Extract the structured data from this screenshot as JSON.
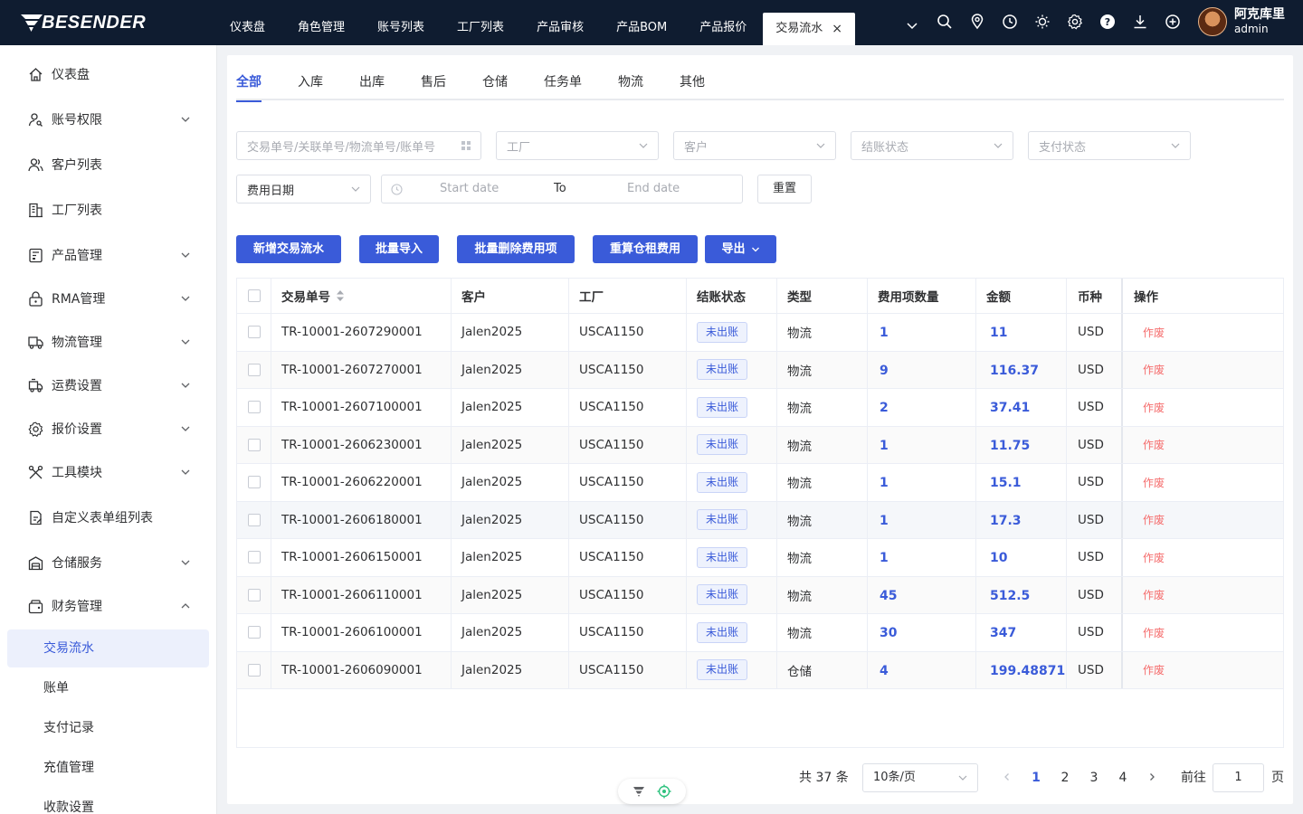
{
  "brand": "BESENDER",
  "topnav": {
    "items": [
      "仪表盘",
      "角色管理",
      "账号列表",
      "工厂列表",
      "产品审核",
      "产品BOM",
      "产品报价"
    ],
    "active_tab": "交易流水",
    "close_symbol": "×"
  },
  "top_icons": [
    "search-icon",
    "location-icon",
    "clock-icon",
    "sun-icon",
    "gear-icon",
    "help-icon",
    "download-icon",
    "plus-circle-icon"
  ],
  "user": {
    "name": "阿克库里",
    "role": "admin"
  },
  "sidebar": {
    "items": [
      {
        "label": "仪表盘",
        "icon": "home-icon",
        "has_children": false
      },
      {
        "label": "账号权限",
        "icon": "user-key-icon",
        "has_children": true
      },
      {
        "label": "客户列表",
        "icon": "users-icon",
        "has_children": false
      },
      {
        "label": "工厂列表",
        "icon": "building-icon",
        "has_children": false
      },
      {
        "label": "产品管理",
        "icon": "product-icon",
        "has_children": true
      },
      {
        "label": "RMA管理",
        "icon": "lock-icon",
        "has_children": true
      },
      {
        "label": "物流管理",
        "icon": "truck-icon",
        "has_children": true
      },
      {
        "label": "运费设置",
        "icon": "freight-icon",
        "has_children": true
      },
      {
        "label": "报价设置",
        "icon": "gear-icon",
        "has_children": true
      },
      {
        "label": "工具模块",
        "icon": "tools-icon",
        "has_children": true
      },
      {
        "label": "自定义表单组列表",
        "icon": "form-icon",
        "has_children": false
      },
      {
        "label": "仓储服务",
        "icon": "warehouse-icon",
        "has_children": true
      },
      {
        "label": "财务管理",
        "icon": "finance-icon",
        "has_children": true,
        "expanded": true
      }
    ],
    "sub_items": [
      "交易流水",
      "账单",
      "支付记录",
      "充值管理",
      "收款设置"
    ],
    "active_sub": "交易流水"
  },
  "tabs": [
    "全部",
    "入库",
    "出库",
    "售后",
    "仓储",
    "任务单",
    "物流",
    "其他"
  ],
  "active_tab_index": 0,
  "filters": {
    "search_placeholder": "交易单号/关联单号/物流单号/账单号",
    "factory_placeholder": "工厂",
    "customer_placeholder": "客户",
    "settle_status_placeholder": "结账状态",
    "pay_status_placeholder": "支付状态",
    "date_type": "费用日期",
    "start_placeholder": "Start date",
    "range_separator": "To",
    "end_placeholder": "End date",
    "reset_label": "重置"
  },
  "actions": {
    "add": "新增交易流水",
    "import": "批量导入",
    "batch_delete": "批量删除费用项",
    "recalc": "重算仓租费用",
    "export": "导出"
  },
  "table": {
    "columns": [
      "交易单号",
      "客户",
      "工厂",
      "结账状态",
      "类型",
      "费用项数量",
      "金额",
      "币种",
      "操作"
    ],
    "rows": [
      {
        "id": "TR-10001-2607290001",
        "customer": "Jalen2025",
        "factory": "USCA1150",
        "status": "未出账",
        "type": "物流",
        "count": "1",
        "amount": "11",
        "currency": "USD",
        "action": "作废"
      },
      {
        "id": "TR-10001-2607270001",
        "customer": "Jalen2025",
        "factory": "USCA1150",
        "status": "未出账",
        "type": "物流",
        "count": "9",
        "amount": "116.37",
        "currency": "USD",
        "action": "作废"
      },
      {
        "id": "TR-10001-2607100001",
        "customer": "Jalen2025",
        "factory": "USCA1150",
        "status": "未出账",
        "type": "物流",
        "count": "2",
        "amount": "37.41",
        "currency": "USD",
        "action": "作废"
      },
      {
        "id": "TR-10001-2606230001",
        "customer": "Jalen2025",
        "factory": "USCA1150",
        "status": "未出账",
        "type": "物流",
        "count": "1",
        "amount": "11.75",
        "currency": "USD",
        "action": "作废"
      },
      {
        "id": "TR-10001-2606220001",
        "customer": "Jalen2025",
        "factory": "USCA1150",
        "status": "未出账",
        "type": "物流",
        "count": "1",
        "amount": "15.1",
        "currency": "USD",
        "action": "作废"
      },
      {
        "id": "TR-10001-2606180001",
        "customer": "Jalen2025",
        "factory": "USCA1150",
        "status": "未出账",
        "type": "物流",
        "count": "1",
        "amount": "17.3",
        "currency": "USD",
        "action": "作废"
      },
      {
        "id": "TR-10001-2606150001",
        "customer": "Jalen2025",
        "factory": "USCA1150",
        "status": "未出账",
        "type": "物流",
        "count": "1",
        "amount": "10",
        "currency": "USD",
        "action": "作废"
      },
      {
        "id": "TR-10001-2606110001",
        "customer": "Jalen2025",
        "factory": "USCA1150",
        "status": "未出账",
        "type": "物流",
        "count": "45",
        "amount": "512.5",
        "currency": "USD",
        "action": "作废"
      },
      {
        "id": "TR-10001-2606100001",
        "customer": "Jalen2025",
        "factory": "USCA1150",
        "status": "未出账",
        "type": "物流",
        "count": "30",
        "amount": "347",
        "currency": "USD",
        "action": "作废"
      },
      {
        "id": "TR-10001-2606090001",
        "customer": "Jalen2025",
        "factory": "USCA1150",
        "status": "未出账",
        "type": "仓储",
        "count": "4",
        "amount": "199.48871",
        "currency": "USD",
        "action": "作废"
      }
    ]
  },
  "pagination": {
    "total_text": "共 37 条",
    "page_size": "10条/页",
    "pages": [
      "1",
      "2",
      "3",
      "4"
    ],
    "current": "1",
    "goto_prefix": "前往",
    "goto_value": "1",
    "goto_suffix": "页"
  },
  "colors": {
    "primary": "#3a5bd9",
    "topbar": "#0f1c30",
    "danger": "#f56c6c"
  }
}
